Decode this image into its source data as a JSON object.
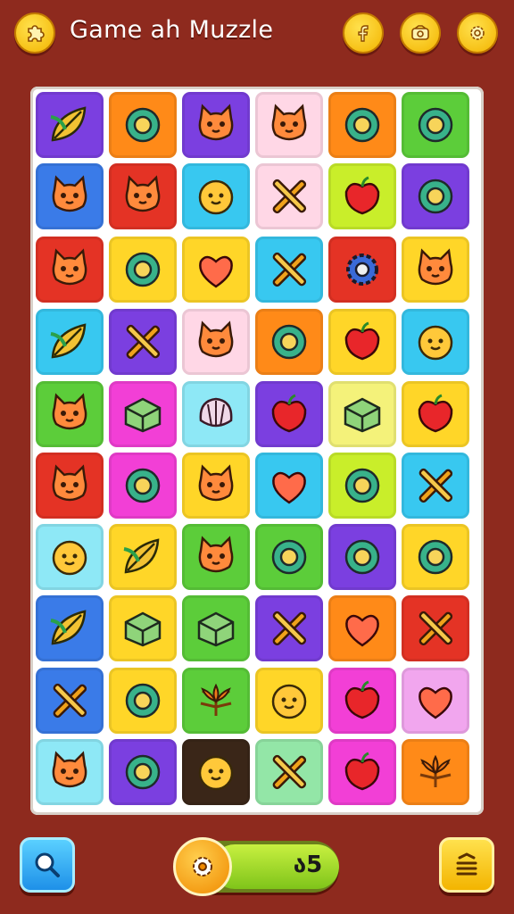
{
  "header": {
    "title": "Game ah Muzzle",
    "buttons": [
      "puzzle-icon",
      "f-icon",
      "wallet-icon",
      "gear-icon"
    ]
  },
  "palette": {
    "purple": "#7b3fe0",
    "orange": "#ff8a18",
    "pink": "#ffd7e6",
    "teal": "#38c8f0",
    "green": "#5ccd3a",
    "blue": "#3a7be8",
    "red": "#e43325",
    "yellow": "#ffd628",
    "magenta": "#f23fd6",
    "lime": "#c9ee2a",
    "lightblue": "#8ee8f6",
    "dark": "#3a2618",
    "mint": "#93e6a7",
    "lightyellow": "#f4f27a",
    "lavender": "#f1a6ee"
  },
  "board": {
    "rows": [
      [
        {
          "c": "purple",
          "i": "leaf"
        },
        {
          "c": "orange",
          "i": "ring"
        },
        {
          "c": "purple",
          "i": "cat"
        },
        {
          "c": "pink",
          "i": "cat"
        },
        {
          "c": "orange",
          "i": "ring"
        },
        {
          "c": "green",
          "i": "ring"
        }
      ],
      [
        {
          "c": "blue",
          "i": "cat"
        },
        {
          "c": "red",
          "i": "cat"
        },
        {
          "c": "teal",
          "i": "blob"
        },
        {
          "c": "pink",
          "i": "sticks"
        },
        {
          "c": "lime",
          "i": "apple"
        },
        {
          "c": "purple",
          "i": "ring"
        }
      ],
      [
        {
          "c": "red",
          "i": "cat"
        },
        {
          "c": "yellow",
          "i": "ring"
        },
        {
          "c": "yellow",
          "i": "heart"
        },
        {
          "c": "teal",
          "i": "sticks"
        },
        {
          "c": "red",
          "i": "gear"
        },
        {
          "c": "yellow",
          "i": "cat"
        }
      ],
      [
        {
          "c": "teal",
          "i": "leaf"
        },
        {
          "c": "purple",
          "i": "sticks"
        },
        {
          "c": "pink",
          "i": "cat"
        },
        {
          "c": "orange",
          "i": "ring"
        },
        {
          "c": "yellow",
          "i": "apple"
        },
        {
          "c": "teal",
          "i": "blob"
        }
      ],
      [
        {
          "c": "green",
          "i": "cat"
        },
        {
          "c": "magenta",
          "i": "box"
        },
        {
          "c": "lightblue",
          "i": "shell"
        },
        {
          "c": "purple",
          "i": "apple"
        },
        {
          "c": "lightyellow",
          "i": "box"
        },
        {
          "c": "yellow",
          "i": "apple"
        }
      ],
      [
        {
          "c": "red",
          "i": "cat"
        },
        {
          "c": "magenta",
          "i": "ring"
        },
        {
          "c": "yellow",
          "i": "cat"
        },
        {
          "c": "teal",
          "i": "heart"
        },
        {
          "c": "lime",
          "i": "ring"
        },
        {
          "c": "teal",
          "i": "sticks"
        }
      ],
      [
        {
          "c": "lightblue",
          "i": "blob"
        },
        {
          "c": "yellow",
          "i": "leaf"
        },
        {
          "c": "green",
          "i": "cat"
        },
        {
          "c": "green",
          "i": "ring"
        },
        {
          "c": "purple",
          "i": "ring"
        },
        {
          "c": "yellow",
          "i": "ring"
        }
      ],
      [
        {
          "c": "blue",
          "i": "leaf"
        },
        {
          "c": "yellow",
          "i": "box"
        },
        {
          "c": "green",
          "i": "box"
        },
        {
          "c": "purple",
          "i": "sticks"
        },
        {
          "c": "orange",
          "i": "heart"
        },
        {
          "c": "red",
          "i": "sticks"
        }
      ],
      [
        {
          "c": "blue",
          "i": "sticks"
        },
        {
          "c": "yellow",
          "i": "ring"
        },
        {
          "c": "green",
          "i": "flower"
        },
        {
          "c": "yellow",
          "i": "blob"
        },
        {
          "c": "magenta",
          "i": "apple"
        },
        {
          "c": "lavender",
          "i": "heart"
        }
      ],
      [
        {
          "c": "lightblue",
          "i": "cat"
        },
        {
          "c": "purple",
          "i": "ring"
        },
        {
          "c": "dark",
          "i": "blob"
        },
        {
          "c": "mint",
          "i": "sticks"
        },
        {
          "c": "magenta",
          "i": "apple"
        },
        {
          "c": "orange",
          "i": "flower"
        }
      ]
    ]
  },
  "footer": {
    "search_icon": "search-icon",
    "menu_icon": "menu-icon",
    "progress": 0.78,
    "score": "ა5"
  }
}
